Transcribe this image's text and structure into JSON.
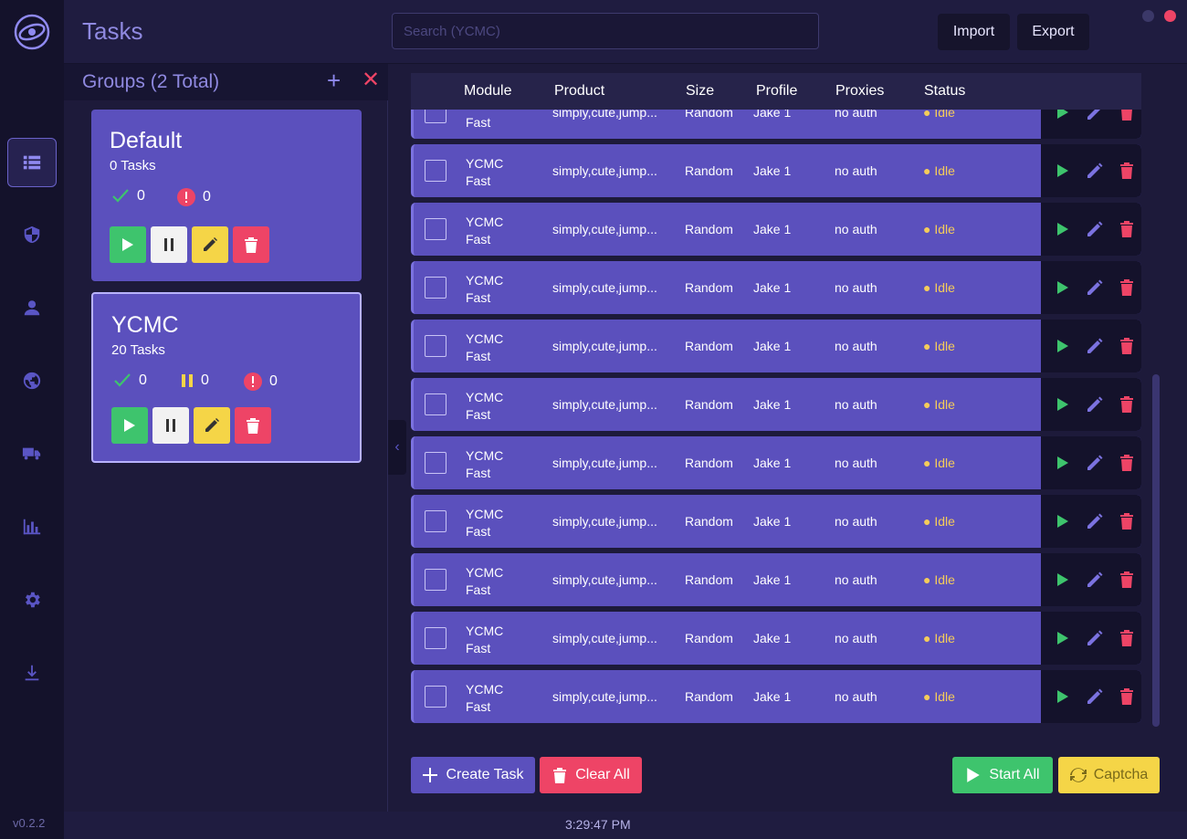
{
  "app": {
    "title": "Tasks",
    "version": "v0.2.2",
    "clock": "3:29:47 PM"
  },
  "colors": {
    "accent": "#5b50bd",
    "green": "#3ec46d",
    "yellow": "#f5d547",
    "red": "#ee4466"
  },
  "sidebar": {
    "items": [
      {
        "icon": "task-list-icon",
        "active": true
      },
      {
        "icon": "shield-icon",
        "active": false
      },
      {
        "icon": "user-icon",
        "active": false
      },
      {
        "icon": "proxy-globe-icon",
        "active": false
      },
      {
        "icon": "shipping-truck-icon",
        "active": false
      },
      {
        "icon": "bar-chart-icon",
        "active": false
      },
      {
        "icon": "gear-icon",
        "active": false
      },
      {
        "icon": "download-icon",
        "active": false
      }
    ]
  },
  "header": {
    "search_placeholder": "Search (YCMC)",
    "import_label": "Import",
    "export_label": "Export"
  },
  "groups": {
    "title": "Groups (2 Total)",
    "items": [
      {
        "name": "Default",
        "count": "0 Tasks",
        "success": "0",
        "error": "0"
      },
      {
        "name": "YCMC",
        "count": "20 Tasks",
        "success": "0",
        "paused": "0",
        "error": "0"
      }
    ]
  },
  "table": {
    "headers": [
      "Module",
      "Product",
      "Size",
      "Profile",
      "Proxies",
      "Status"
    ],
    "rows": [
      {
        "module": "YCMC",
        "mode": "Fast",
        "product": "simply,cute,jump...",
        "size": "Random",
        "profile": "Jake 1",
        "proxies": "no auth",
        "status": "Idle"
      },
      {
        "module": "YCMC",
        "mode": "Fast",
        "product": "simply,cute,jump...",
        "size": "Random",
        "profile": "Jake 1",
        "proxies": "no auth",
        "status": "Idle"
      },
      {
        "module": "YCMC",
        "mode": "Fast",
        "product": "simply,cute,jump...",
        "size": "Random",
        "profile": "Jake 1",
        "proxies": "no auth",
        "status": "Idle"
      },
      {
        "module": "YCMC",
        "mode": "Fast",
        "product": "simply,cute,jump...",
        "size": "Random",
        "profile": "Jake 1",
        "proxies": "no auth",
        "status": "Idle"
      },
      {
        "module": "YCMC",
        "mode": "Fast",
        "product": "simply,cute,jump...",
        "size": "Random",
        "profile": "Jake 1",
        "proxies": "no auth",
        "status": "Idle"
      },
      {
        "module": "YCMC",
        "mode": "Fast",
        "product": "simply,cute,jump...",
        "size": "Random",
        "profile": "Jake 1",
        "proxies": "no auth",
        "status": "Idle"
      },
      {
        "module": "YCMC",
        "mode": "Fast",
        "product": "simply,cute,jump...",
        "size": "Random",
        "profile": "Jake 1",
        "proxies": "no auth",
        "status": "Idle"
      },
      {
        "module": "YCMC",
        "mode": "Fast",
        "product": "simply,cute,jump...",
        "size": "Random",
        "profile": "Jake 1",
        "proxies": "no auth",
        "status": "Idle"
      },
      {
        "module": "YCMC",
        "mode": "Fast",
        "product": "simply,cute,jump...",
        "size": "Random",
        "profile": "Jake 1",
        "proxies": "no auth",
        "status": "Idle"
      },
      {
        "module": "YCMC",
        "mode": "Fast",
        "product": "simply,cute,jump...",
        "size": "Random",
        "profile": "Jake 1",
        "proxies": "no auth",
        "status": "Idle"
      },
      {
        "module": "YCMC",
        "mode": "Fast",
        "product": "simply,cute,jump...",
        "size": "Random",
        "profile": "Jake 1",
        "proxies": "no auth",
        "status": "Idle"
      }
    ]
  },
  "actions": {
    "create": "Create Task",
    "clear": "Clear All",
    "start": "Start All",
    "captcha": "Captcha"
  }
}
